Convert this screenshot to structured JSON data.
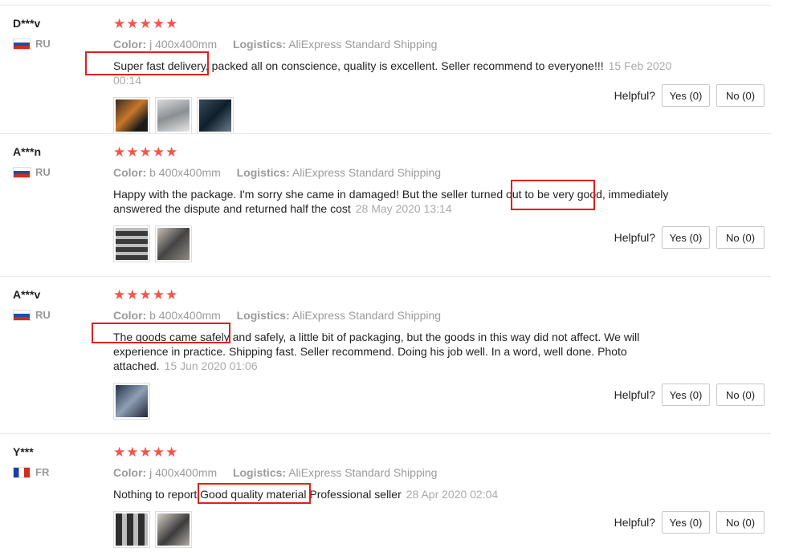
{
  "helpful_label": "Helpful?",
  "reviews": [
    {
      "user": "D***v",
      "country": "RU",
      "stars": "★★★★★",
      "color_label": "Color:",
      "color_value": "j 400x400mm",
      "logistics_label": "Logistics:",
      "logistics_value": "AliExpress Standard Shipping",
      "text": "Super fast delivery, packed all on conscience, quality is excellent. Seller recommend to everyone!!!",
      "date": "15 Feb 2020 00:14",
      "yes": "Yes (0)",
      "no": "No (0)"
    },
    {
      "user": "A***n",
      "country": "RU",
      "stars": "★★★★★",
      "color_label": "Color:",
      "color_value": "b 400x400mm",
      "logistics_label": "Logistics:",
      "logistics_value": "AliExpress Standard Shipping",
      "text": "Happy with the package. I'm sorry she came in damaged! But the seller turned out to be very good, immediately answered the dispute and returned half the cost",
      "date": "28 May 2020 13:14",
      "yes": "Yes (0)",
      "no": "No (0)"
    },
    {
      "user": "A***v",
      "country": "RU",
      "stars": "★★★★★",
      "color_label": "Color:",
      "color_value": "b 400x400mm",
      "logistics_label": "Logistics:",
      "logistics_value": "AliExpress Standard Shipping",
      "text": "The goods came safely and safely, a little bit of packaging, but the goods in this way did not affect. We will experience in practice. Shipping fast. Seller recommend. Doing his job well. In a word, well done. Photo attached.",
      "date": "15 Jun 2020 01:06",
      "yes": "Yes (0)",
      "no": "No (0)"
    },
    {
      "user": "Y***",
      "country": "FR",
      "stars": "★★★★★",
      "color_label": "Color:",
      "color_value": "j 400x400mm",
      "logistics_label": "Logistics:",
      "logistics_value": "AliExpress Standard Shipping",
      "text": "Nothing to report Good quality material Professional seller",
      "date": "28 Apr 2020 02:04",
      "yes": "Yes (0)",
      "no": "No (0)"
    }
  ]
}
